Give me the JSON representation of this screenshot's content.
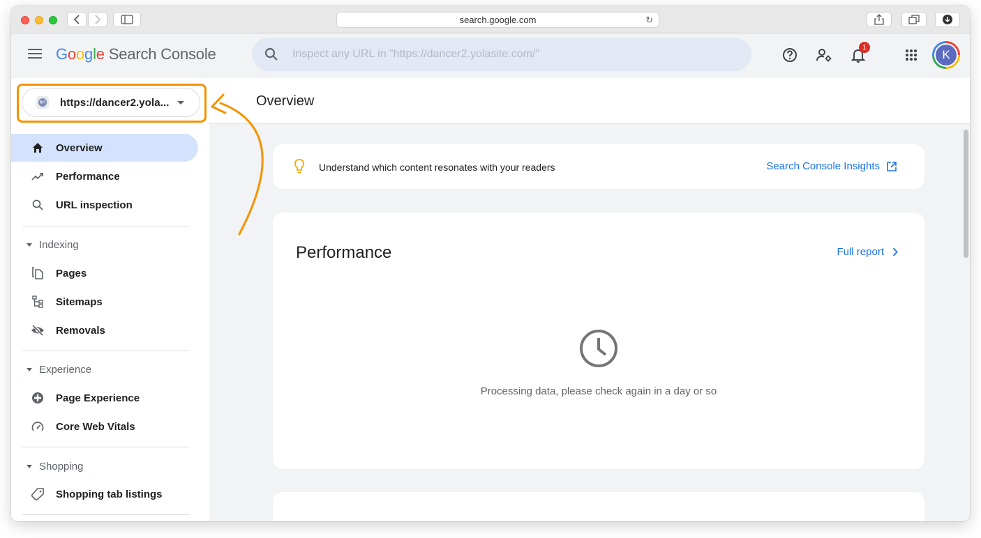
{
  "browser": {
    "url": "search.google.com"
  },
  "header": {
    "logo": {
      "G": "G",
      "o1": "o",
      "o2": "o",
      "g": "g",
      "l": "l",
      "e": "e",
      "product": "Search Console"
    },
    "search_placeholder": "Inspect any URL in \"https://dancer2.yolasite.com/\"",
    "notification_count": "1",
    "avatar_letter": "K"
  },
  "sidebar": {
    "property": "https://dancer2.yola...",
    "items_top": [
      {
        "label": "Overview",
        "icon": "home-icon",
        "active": true
      },
      {
        "label": "Performance",
        "icon": "trending-up-icon"
      },
      {
        "label": "URL inspection",
        "icon": "search-icon"
      }
    ],
    "sections": [
      {
        "title": "Indexing",
        "items": [
          {
            "label": "Pages",
            "icon": "pages-icon"
          },
          {
            "label": "Sitemaps",
            "icon": "sitemap-icon"
          },
          {
            "label": "Removals",
            "icon": "eye-off-icon"
          }
        ]
      },
      {
        "title": "Experience",
        "items": [
          {
            "label": "Page Experience",
            "icon": "plus-circle-icon"
          },
          {
            "label": "Core Web Vitals",
            "icon": "gauge-icon"
          }
        ]
      },
      {
        "title": "Shopping",
        "items": [
          {
            "label": "Shopping tab listings",
            "icon": "tag-icon"
          }
        ]
      }
    ]
  },
  "main": {
    "title": "Overview",
    "insight": {
      "text": "Understand which content resonates with your readers",
      "link": "Search Console Insights"
    },
    "performance": {
      "title": "Performance",
      "link": "Full report",
      "status": "Processing data, please check again in a day or so"
    }
  },
  "colors": {
    "accent": "#1a73e8",
    "highlight": "#f39200",
    "active_nav": "#d3e3fd"
  }
}
